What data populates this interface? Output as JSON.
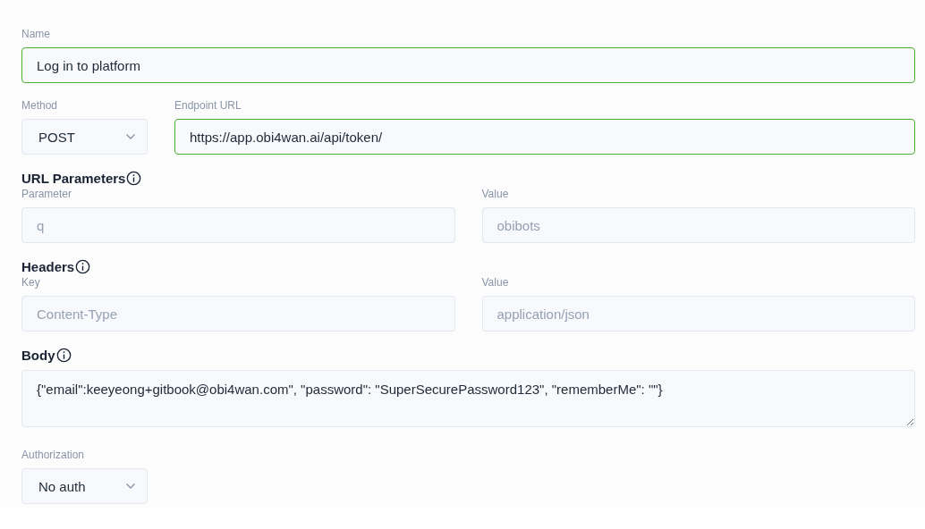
{
  "name": {
    "label": "Name",
    "value": "Log in to platform",
    "valid": true
  },
  "method": {
    "label": "Method",
    "value": "POST"
  },
  "endpoint": {
    "label": "Endpoint URL",
    "value": "https://app.obi4wan.ai/api/token/",
    "valid": true
  },
  "url_parameters": {
    "title": "URL Parameters",
    "key_label": "Parameter",
    "value_label": "Value",
    "key_placeholder": "q",
    "value_placeholder": "obibots"
  },
  "headers": {
    "title": "Headers",
    "key_label": "Key",
    "value_label": "Value",
    "key_placeholder": "Content-Type",
    "value_placeholder": "application/json"
  },
  "body": {
    "title": "Body",
    "value": "{\"email\":keeyeong+gitbook@obi4wan.com\", \"password\": \"SuperSecurePassword123\", \"rememberMe\": \"\"}"
  },
  "authorization": {
    "label": "Authorization",
    "value": "No auth"
  }
}
